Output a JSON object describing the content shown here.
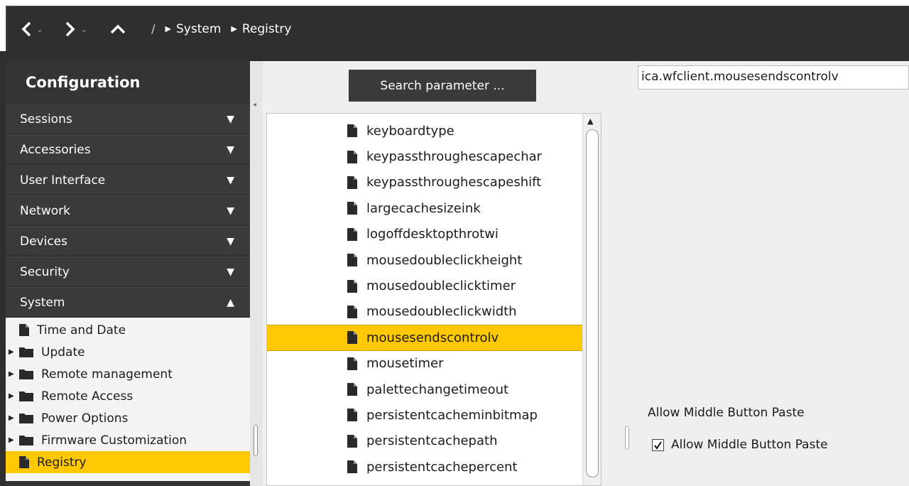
{
  "nav": {
    "back_caret": "⌄",
    "forward_caret": "⌄",
    "breadcrumb_root": "/",
    "breadcrumbs": [
      "System",
      "Registry"
    ]
  },
  "sidebar": {
    "title": "Configuration",
    "sections": [
      {
        "label": "Sessions",
        "arrow": "▼"
      },
      {
        "label": "Accessories",
        "arrow": "▼"
      },
      {
        "label": "User Interface",
        "arrow": "▼"
      },
      {
        "label": "Network",
        "arrow": "▼"
      },
      {
        "label": "Devices",
        "arrow": "▼"
      },
      {
        "label": "Security",
        "arrow": "▼"
      },
      {
        "label": "System",
        "arrow": "▲"
      }
    ],
    "tree": [
      {
        "label": "Time and Date",
        "icon": "file-icon",
        "expander": ""
      },
      {
        "label": "Update",
        "icon": "folder-icon",
        "expander": "▶"
      },
      {
        "label": "Remote management",
        "icon": "folder-icon",
        "expander": "▶"
      },
      {
        "label": "Remote Access",
        "icon": "folder-icon",
        "expander": "▶"
      },
      {
        "label": "Power Options",
        "icon": "folder-icon",
        "expander": "▶"
      },
      {
        "label": "Firmware Customization",
        "icon": "folder-icon",
        "expander": "▶"
      },
      {
        "label": "Registry",
        "icon": "file-icon",
        "expander": "",
        "selected": true
      }
    ]
  },
  "main": {
    "search_label": "Search parameter ...",
    "path_value": "ica.wfclient.mousesendscontrolv",
    "params": [
      "keyboardtype",
      "keypassthroughescapechar",
      "keypassthroughescapeshift",
      "largecachesizeink",
      "logoffdesktopthrotwi",
      "mousedoubleclickheight",
      "mousedoubleclicktimer",
      "mousedoubleclickwidth",
      "mousesendscontrolv",
      "mousetimer",
      "palettechangetimeout",
      "persistentcacheminbitmap",
      "persistentcachepath",
      "persistentcachepercent"
    ],
    "selected_param": "mousesendscontrolv",
    "setting_title": "Allow Middle Button Paste",
    "setting_checkbox_label": "Allow Middle Button Paste",
    "setting_checked": true
  },
  "colors": {
    "accent": "#ffc800",
    "dark": "#333333"
  }
}
